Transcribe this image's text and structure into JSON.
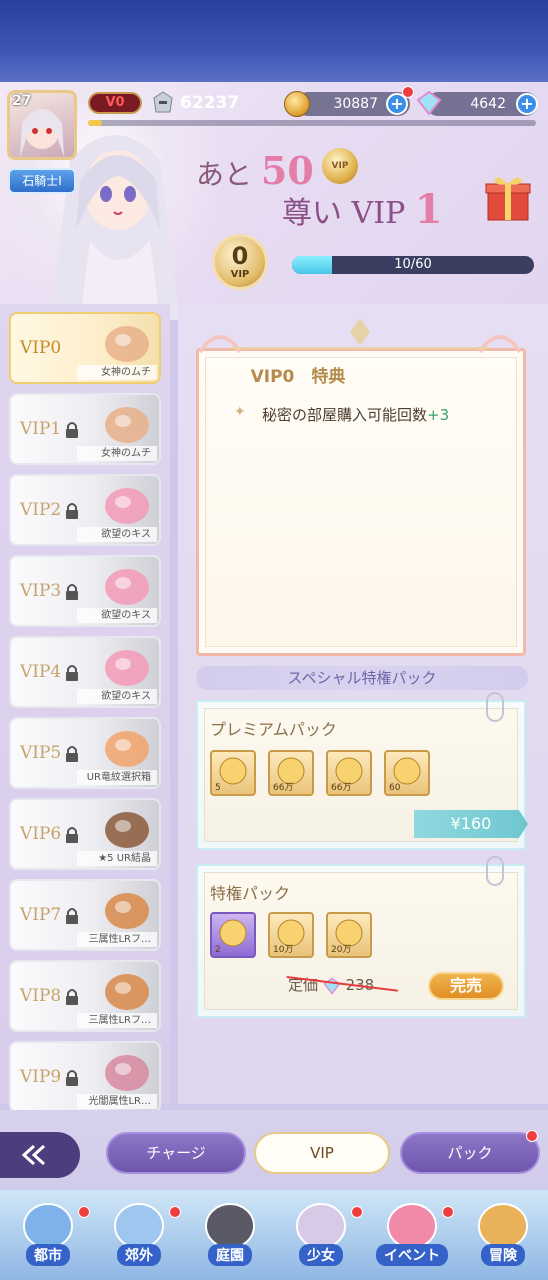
{
  "player": {
    "level": "27",
    "rank_title": "石騎士Ⅰ",
    "vip_badge": "V0",
    "power": "62237"
  },
  "resources": {
    "gold": "30887",
    "gems": "4642"
  },
  "promo": {
    "line1_prefix": "あと",
    "line1_number": "50",
    "line2_prefix": "尊い",
    "line2_vip": "VIP",
    "line2_level": "1",
    "vip_coin_label": "VIP"
  },
  "vip_status": {
    "level": "0",
    "label": "VIP",
    "progress_text": "10/60",
    "progress_fraction": 0.1667
  },
  "vip_list": [
    {
      "label": "VIP0",
      "caption": "女神のムチ",
      "locked": false,
      "selected": true
    },
    {
      "label": "VIP1",
      "caption": "女神のムチ",
      "locked": true
    },
    {
      "label": "VIP2",
      "caption": "欲望のキス",
      "locked": true
    },
    {
      "label": "VIP3",
      "caption": "欲望のキス",
      "locked": true
    },
    {
      "label": "VIP4",
      "caption": "欲望のキス",
      "locked": true
    },
    {
      "label": "VIP5",
      "caption": "UR竜紋選択箱",
      "locked": true
    },
    {
      "label": "VIP6",
      "caption": "★5 UR結晶",
      "locked": true
    },
    {
      "label": "VIP7",
      "caption": "三属性LRフ…",
      "locked": true
    },
    {
      "label": "VIP8",
      "caption": "三属性LRフ…",
      "locked": true
    },
    {
      "label": "VIP9",
      "caption": "光闇属性LR…",
      "locked": true
    }
  ],
  "benefits": {
    "title": "VIP0　特典",
    "perks": [
      {
        "text": "秘密の部屋購入可能回数",
        "bonus": "+3"
      }
    ]
  },
  "special_section": {
    "title": "スペシャル特権パック"
  },
  "premium_pack": {
    "title": "プレミアムパック",
    "price": "¥160",
    "items": [
      {
        "icon": "whip-icon",
        "qty": "5"
      },
      {
        "icon": "gold-coin-icon",
        "qty": "66万"
      },
      {
        "icon": "exp-gem-icon",
        "qty": "66万"
      },
      {
        "icon": "vip-coin-icon",
        "qty": "60"
      }
    ]
  },
  "privilege_pack": {
    "title": "特権パック",
    "original_price_label": "定価",
    "original_price": "238",
    "button": "完売",
    "items": [
      {
        "icon": "staff-icon",
        "qty": "2"
      },
      {
        "icon": "exp-gem-icon",
        "qty": "10万"
      },
      {
        "icon": "gold-coin-icon",
        "qty": "20万"
      }
    ]
  },
  "tabs": [
    {
      "label": "チャージ"
    },
    {
      "label": "VIP",
      "active": true
    },
    {
      "label": "パック"
    }
  ],
  "nav": [
    {
      "label": "都市"
    },
    {
      "label": "郊外"
    },
    {
      "label": "庭園"
    },
    {
      "label": "少女"
    },
    {
      "label": "イベント"
    },
    {
      "label": "冒険"
    }
  ],
  "colors": {
    "accent_pink": "#e47da8",
    "gold": "#e2bb69",
    "tab_purple": "#7a62b8",
    "progress_cyan": "#48c6e6",
    "sold_orange": "#e08f23",
    "discount_red": "#e63b3b"
  }
}
